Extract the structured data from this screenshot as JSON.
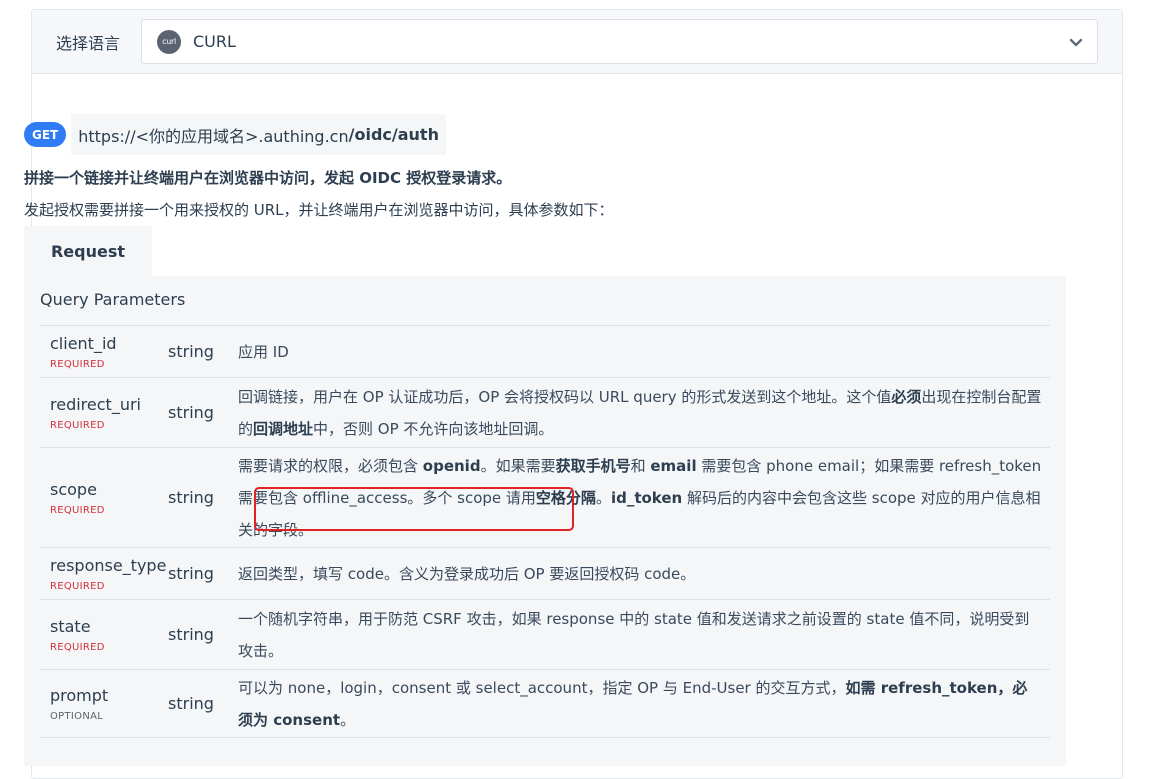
{
  "language_bar": {
    "label": "选择语言",
    "icon_text": "curl",
    "selected": "CURL"
  },
  "endpoint": {
    "method": "GET",
    "url_prefix": "https://<你的应用域名>.authing.cn",
    "url_path": "/oidc/auth"
  },
  "headline": "拼接一个链接并让终端用户在浏览器中访问，发起 OIDC 授权登录请求。",
  "subline": "发起授权需要拼接一个用来授权的 URL，并让终端用户在浏览器中访问，具体参数如下：",
  "tab": {
    "label": "Request"
  },
  "params": {
    "title": "Query Parameters",
    "rows": [
      {
        "name": "client_id",
        "req": "REQUIRED",
        "type": "string",
        "desc": [
          {
            "t": "应用 ID"
          }
        ]
      },
      {
        "name": "redirect_uri",
        "req": "REQUIRED",
        "type": "string",
        "desc": [
          {
            "t": "回调链接，用户在 OP 认证成功后，OP 会将授权码以 URL query 的形式发送到这个地址。这个值"
          },
          {
            "t": "必须",
            "b": true
          },
          {
            "t": "出现在控制台配置的"
          },
          {
            "t": "回调地址",
            "b": true
          },
          {
            "t": "中，否则 OP 不允许向该地址回调。"
          }
        ]
      },
      {
        "name": "scope",
        "req": "REQUIRED",
        "type": "string",
        "desc": [
          {
            "t": "需要请求的权限，必须包含 "
          },
          {
            "t": "openid",
            "b": true
          },
          {
            "t": "。如果需要"
          },
          {
            "t": "获取手机号",
            "b": true
          },
          {
            "t": "和 "
          },
          {
            "t": "email",
            "b": true
          },
          {
            "t": " 需要包含 phone email；如果需要 refresh_token 需要包含 offline_access。多个 scope 请用"
          },
          {
            "t": "空格分隔",
            "b": true
          },
          {
            "t": "。"
          },
          {
            "t": "id_token",
            "b": true
          },
          {
            "t": " 解码后的内容中会包含这些 scope 对应的用户信息相关的字段。"
          }
        ]
      },
      {
        "name": "response_type",
        "req": "REQUIRED",
        "type": "string",
        "desc": [
          {
            "t": "返回类型，填写 code。含义为登录成功后 OP 要返回授权码 code。"
          }
        ]
      },
      {
        "name": "state",
        "req": "REQUIRED",
        "type": "string",
        "desc": [
          {
            "t": "一个随机字符串，用于防范 CSRF 攻击，如果 response 中的 state 值和发送请求之前设置的 state 值不同，说明受到攻击。"
          }
        ]
      },
      {
        "name": "prompt",
        "req": "OPTIONAL",
        "type": "string",
        "desc": [
          {
            "t": "可以为 none，login，consent 或 select_account，指定 OP 与 End-User 的交互方式，"
          },
          {
            "t": "如需 refresh_token，必须为 consent",
            "b": true
          },
          {
            "t": "。"
          }
        ]
      }
    ]
  },
  "colors": {
    "accent": "#2f7cf6",
    "required": "#d0323b",
    "highlight": "#e02424"
  }
}
